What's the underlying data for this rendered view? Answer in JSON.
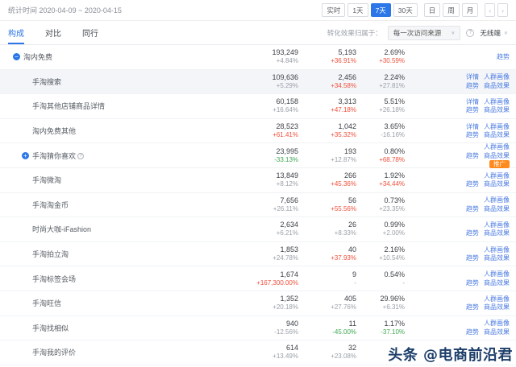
{
  "header": {
    "stat_time_label": "统计时间",
    "date_range": "2020-04-09 ~ 2020-04-15",
    "range_buttons": [
      "实时",
      "1天",
      "7天",
      "30天"
    ],
    "active_range": "7天",
    "period_buttons": [
      "日",
      "周",
      "月"
    ]
  },
  "tabs": [
    {
      "label": "构成",
      "active": true
    },
    {
      "label": "对比",
      "active": false
    },
    {
      "label": "同行",
      "active": false
    }
  ],
  "controls": {
    "conversion_label": "转化效果归属于：",
    "conversion_value": "每一次访问来源",
    "terminal_value": "无线端"
  },
  "icons": {
    "chevron_down": "∨",
    "prev": "‹",
    "next": "›",
    "minus": "−",
    "plus": "+",
    "help": "?",
    "info": "?"
  },
  "colors": {
    "accent_blue": "#2b77e8",
    "link_blue": "#4a7ae0",
    "up_red": "#f0503c",
    "down_green": "#3fa854",
    "neutral_gray": "#9aa0a8",
    "badge_orange": "#ff8a1e",
    "watermark_navy": "#1d3e6b",
    "highlight_row": "#f3f5f9"
  },
  "watermark": "头条 @电商前沿君",
  "table": {
    "rows": [
      {
        "name": "淘内免费",
        "indent": "root",
        "expand": "minus",
        "help": false,
        "highlight": false,
        "col1": "193,249",
        "col1_change": "+4.84%",
        "col1_color": "gray",
        "col2": "5,193",
        "col2_change": "+36.91%",
        "col2_color": "red",
        "col3": "2.69%",
        "col3_change": "+30.59%",
        "col3_color": "red",
        "links": [
          [
            "趋势"
          ]
        ],
        "badge": ""
      },
      {
        "name": "手淘搜索",
        "indent": "sub",
        "expand": null,
        "help": false,
        "highlight": true,
        "col1": "109,636",
        "col1_change": "+5.29%",
        "col1_color": "gray",
        "col2": "2,456",
        "col2_change": "+34.58%",
        "col2_color": "red",
        "col3": "2.24%",
        "col3_change": "+27.81%",
        "col3_color": "gray",
        "links": [
          [
            "详情",
            "人群画像"
          ],
          [
            "趋势",
            "商品效果"
          ]
        ],
        "badge": ""
      },
      {
        "name": "手淘其他店铺商品详情",
        "indent": "sub",
        "expand": null,
        "help": false,
        "highlight": false,
        "col1": "60,158",
        "col1_change": "+16.64%",
        "col1_color": "gray",
        "col2": "3,313",
        "col2_change": "+47.18%",
        "col2_color": "red",
        "col3": "5.51%",
        "col3_change": "+26.18%",
        "col3_color": "gray",
        "links": [
          [
            "详情",
            "人群画像"
          ],
          [
            "趋势",
            "商品效果"
          ]
        ],
        "badge": ""
      },
      {
        "name": "淘内免费其他",
        "indent": "sub",
        "expand": null,
        "help": false,
        "highlight": false,
        "col1": "28,523",
        "col1_change": "+61.41%",
        "col1_color": "red",
        "col2": "1,042",
        "col2_change": "+35.32%",
        "col2_color": "red",
        "col3": "3.65%",
        "col3_change": "-16.16%",
        "col3_color": "gray",
        "links": [
          [
            "详情",
            "人群画像"
          ],
          [
            "趋势",
            "商品效果"
          ]
        ],
        "badge": ""
      },
      {
        "name": "手淘猜你喜欢",
        "indent": "subx",
        "expand": "plus",
        "help": true,
        "highlight": false,
        "col1": "23,995",
        "col1_change": "-33.13%",
        "col1_color": "green",
        "col2": "193",
        "col2_change": "+12.87%",
        "col2_color": "gray",
        "col3": "0.80%",
        "col3_change": "+68.78%",
        "col3_color": "red",
        "links": [
          [
            "人群画像"
          ],
          [
            "趋势",
            "商品效果"
          ]
        ],
        "badge": "推广"
      },
      {
        "name": "手淘微淘",
        "indent": "sub",
        "expand": null,
        "help": false,
        "highlight": false,
        "col1": "13,849",
        "col1_change": "+8.12%",
        "col1_color": "gray",
        "col2": "266",
        "col2_change": "+45.36%",
        "col2_color": "red",
        "col3": "1.92%",
        "col3_change": "+34.44%",
        "col3_color": "red",
        "links": [
          [
            "人群画像"
          ],
          [
            "趋势",
            "商品效果"
          ]
        ],
        "badge": ""
      },
      {
        "name": "手淘淘金币",
        "indent": "sub",
        "expand": null,
        "help": false,
        "highlight": false,
        "col1": "7,656",
        "col1_change": "+26.11%",
        "col1_color": "gray",
        "col2": "56",
        "col2_change": "+55.56%",
        "col2_color": "red",
        "col3": "0.73%",
        "col3_change": "+23.35%",
        "col3_color": "gray",
        "links": [
          [
            "人群画像"
          ],
          [
            "趋势",
            "商品效果"
          ]
        ],
        "badge": ""
      },
      {
        "name": "时尚大咖-iFashion",
        "indent": "sub",
        "expand": null,
        "help": false,
        "highlight": false,
        "col1": "2,634",
        "col1_change": "+6.21%",
        "col1_color": "gray",
        "col2": "26",
        "col2_change": "+8.33%",
        "col2_color": "gray",
        "col3": "0.99%",
        "col3_change": "+2.00%",
        "col3_color": "gray",
        "links": [
          [
            "人群画像"
          ],
          [
            "趋势",
            "商品效果"
          ]
        ],
        "badge": ""
      },
      {
        "name": "手淘拍立淘",
        "indent": "sub",
        "expand": null,
        "help": false,
        "highlight": false,
        "col1": "1,853",
        "col1_change": "+24.78%",
        "col1_color": "gray",
        "col2": "40",
        "col2_change": "+37.93%",
        "col2_color": "red",
        "col3": "2.16%",
        "col3_change": "+10.54%",
        "col3_color": "gray",
        "links": [
          [
            "人群画像"
          ],
          [
            "趋势",
            "商品效果"
          ]
        ],
        "badge": ""
      },
      {
        "name": "手淘标签会场",
        "indent": "sub",
        "expand": null,
        "help": false,
        "highlight": false,
        "col1": "1,674",
        "col1_change": "+167,300.00%",
        "col1_color": "red",
        "col2": "9",
        "col2_change": "-",
        "col2_color": "gray",
        "col3": "0.54%",
        "col3_change": "-",
        "col3_color": "gray",
        "links": [
          [
            "人群画像"
          ],
          [
            "趋势",
            "商品效果"
          ]
        ],
        "badge": ""
      },
      {
        "name": "手淘旺信",
        "indent": "sub",
        "expand": null,
        "help": false,
        "highlight": false,
        "col1": "1,352",
        "col1_change": "+20.18%",
        "col1_color": "gray",
        "col2": "405",
        "col2_change": "+27.76%",
        "col2_color": "gray",
        "col3": "29.96%",
        "col3_change": "+6.31%",
        "col3_color": "gray",
        "links": [
          [
            "人群画像"
          ],
          [
            "趋势",
            "商品效果"
          ]
        ],
        "badge": ""
      },
      {
        "name": "手淘找相似",
        "indent": "sub",
        "expand": null,
        "help": false,
        "highlight": false,
        "col1": "940",
        "col1_change": "-12.56%",
        "col1_color": "gray",
        "col2": "11",
        "col2_change": "-45.00%",
        "col2_color": "green",
        "col3": "1.17%",
        "col3_change": "-37.10%",
        "col3_color": "green",
        "links": [
          [
            "人群画像"
          ],
          [
            "趋势",
            "商品效果"
          ]
        ],
        "badge": ""
      },
      {
        "name": "手淘我的评价",
        "indent": "sub",
        "expand": null,
        "help": false,
        "highlight": false,
        "col1": "614",
        "col1_change": "+13.49%",
        "col1_color": "gray",
        "col2": "32",
        "col2_change": "+23.08%",
        "col2_color": "gray",
        "col3": "",
        "col3_change": "",
        "col3_color": "gray",
        "links": [],
        "badge": ""
      }
    ]
  }
}
